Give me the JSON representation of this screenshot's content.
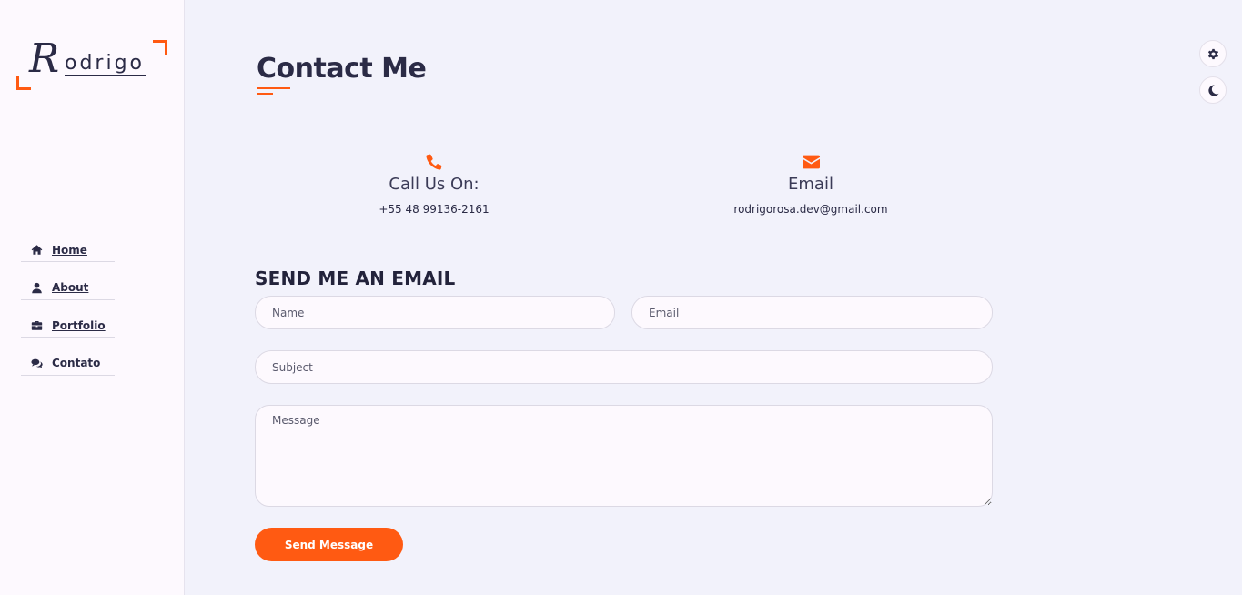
{
  "sidebar": {
    "logo": {
      "initial": "R",
      "rest": "odrigo"
    },
    "nav": [
      {
        "label": "Home",
        "icon": "home-icon"
      },
      {
        "label": "About",
        "icon": "user-icon"
      },
      {
        "label": "Portfolio",
        "icon": "briefcase-icon"
      },
      {
        "label": "Contato",
        "icon": "comments-icon"
      }
    ]
  },
  "page": {
    "title": "Contact Me"
  },
  "contact": {
    "phone": {
      "heading": "Call Us On:",
      "value": "+55 48 99136-2161",
      "icon": "phone-icon"
    },
    "email": {
      "heading": "Email",
      "value": "rodrigorosa.dev@gmail.com",
      "icon": "envelope-icon"
    }
  },
  "form": {
    "title": "SEND ME AN EMAIL",
    "name_placeholder": "Name",
    "email_placeholder": "Email",
    "subject_placeholder": "Subject",
    "message_placeholder": "Message",
    "submit_label": "Send Message"
  },
  "tools": {
    "settings_icon": "gear-icon",
    "theme_icon": "moon-icon"
  },
  "colors": {
    "accent": "#ff5a12",
    "text": "#2b2b46",
    "background": "#f2f2fb",
    "sidebar": "#fdf9fe"
  }
}
